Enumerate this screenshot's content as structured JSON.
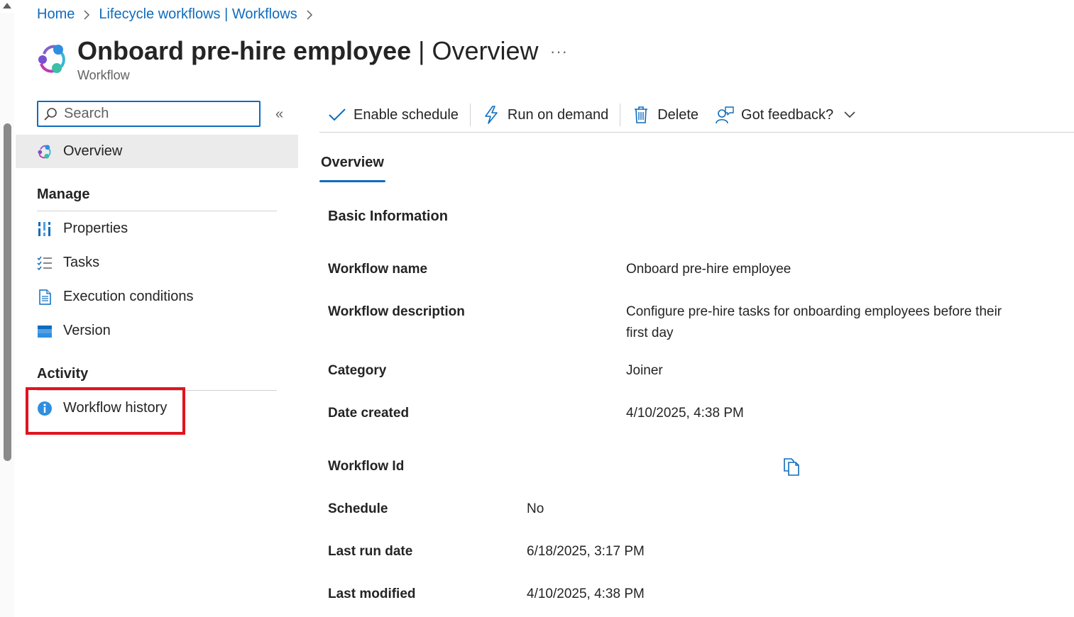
{
  "breadcrumb": {
    "home": "Home",
    "lifecycle": "Lifecycle workflows | Workflows"
  },
  "header": {
    "title_name": "Onboard pre-hire employee",
    "title_section": " | Overview",
    "more": "···",
    "subtitle": "Workflow"
  },
  "sidebar": {
    "search_placeholder": "Search",
    "collapse": "«",
    "overview": "Overview",
    "manage_heading": "Manage",
    "activity_heading": "Activity",
    "items": {
      "properties": "Properties",
      "tasks": "Tasks",
      "execution_conditions": "Execution conditions",
      "version": "Version",
      "workflow_history": "Workflow history"
    }
  },
  "toolbar": {
    "enable_schedule": "Enable schedule",
    "run_on_demand": "Run on demand",
    "delete": "Delete",
    "feedback": "Got feedback?"
  },
  "tabs": {
    "overview": "Overview"
  },
  "basic_info": {
    "title": "Basic Information",
    "workflow_name_label": "Workflow name",
    "workflow_name_value": "Onboard pre-hire employee",
    "workflow_description_label": "Workflow description",
    "workflow_description_line1": "Configure pre-hire tasks for onboarding employees before their",
    "workflow_description_line2": "first day",
    "category_label": "Category",
    "category_value": "Joiner",
    "date_created_label": "Date created",
    "date_created_value": "4/10/2025, 4:38 PM",
    "workflow_id_label": "Workflow Id",
    "schedule_label": "Schedule",
    "schedule_value": "No",
    "last_run_label": "Last run date",
    "last_run_value": "6/18/2025, 3:17 PM",
    "last_modified_label": "Last modified",
    "last_modified_value": "4/10/2025, 4:38 PM"
  },
  "colors": {
    "accent": "#0f6cbd",
    "highlight": "#e0141e",
    "selected_bg": "#ebebeb"
  }
}
